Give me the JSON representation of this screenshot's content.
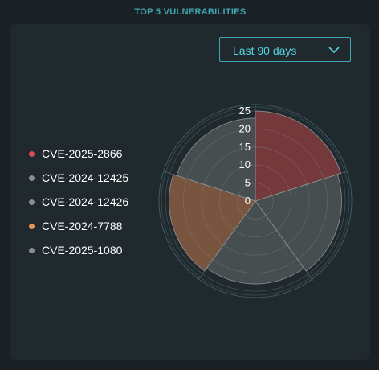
{
  "header": {
    "title": "TOP 5 VULNERABILITIES"
  },
  "filter": {
    "selected": "Last 90 days",
    "icon": "chevron-down-icon"
  },
  "legend": [
    {
      "label": "CVE-2025-2866",
      "color": "#e04a55"
    },
    {
      "label": "CVE-2024-12425",
      "color": "#8a8f93"
    },
    {
      "label": "CVE-2024-12426",
      "color": "#8a8f93"
    },
    {
      "label": "CVE-2024-7788",
      "color": "#e8955a"
    },
    {
      "label": "CVE-2025-1080",
      "color": "#8a8f93"
    }
  ],
  "chart_data": {
    "type": "polar-area",
    "categories": [
      "CVE-2025-2866",
      "CVE-2024-12425",
      "CVE-2024-12426",
      "CVE-2024-7788",
      "CVE-2025-1080"
    ],
    "values": [
      25,
      24,
      23,
      24,
      23
    ],
    "colors": [
      "#7a3a3d",
      "#4a5052",
      "#4a5052",
      "#7e5640",
      "#4a5052"
    ],
    "rlim": [
      0,
      25
    ],
    "rticks": [
      "0",
      "5",
      "10",
      "15",
      "20",
      "25"
    ],
    "grid": true,
    "legend_position": "left"
  }
}
